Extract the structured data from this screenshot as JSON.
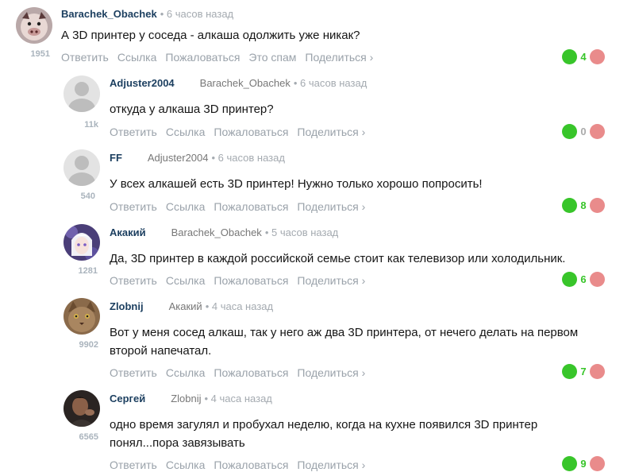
{
  "actions": {
    "reply": "Ответить",
    "link": "Ссылка",
    "report": "Пожаловаться",
    "spam": "Это спам",
    "share": "Поделиться ›"
  },
  "comments": [
    {
      "author": "Barachek_Obachek",
      "reply_to": "",
      "time": "• 6 часов назад",
      "rating": "1951",
      "text": "А 3D принтер у соседа - алкаша одолжить уже никак?",
      "score": "4",
      "score_color": "#38c52a",
      "avatar": "pig-avatar-icon"
    },
    {
      "author": "Adjuster2004",
      "reply_to": "Barachek_Obachek",
      "time": "• 6 часов назад",
      "rating": "11k",
      "text": "откуда у алкаша 3D принтер?",
      "score": "0",
      "score_color": "#aaaaaa",
      "avatar": "default-user-icon"
    },
    {
      "author": "FF",
      "reply_to": "Adjuster2004",
      "time": "• 6 часов назад",
      "rating": "540",
      "text": "У всех алкашей есть 3D принтер! Нужно только хорошо попросить!",
      "score": "8",
      "score_color": "#38c52a",
      "avatar": "default-user-icon"
    },
    {
      "author": "Акакий",
      "reply_to": "Barachek_Obachek",
      "time": "• 5 часов назад",
      "rating": "1281",
      "text": "Да, 3D принтер в каждой российской семье стоит как телевизор или холодильник.",
      "score": "6",
      "score_color": "#38c52a",
      "avatar": "anime-girl-avatar-icon"
    },
    {
      "author": "Zlobnij",
      "reply_to": "Акакий",
      "time": "• 4 часа назад",
      "rating": "9902",
      "text": "Вот у меня сосед алкаш, так у него аж два 3D принтера, от нечего делать на первом второй напечатал.",
      "score": "7",
      "score_color": "#38c52a",
      "avatar": "cat-avatar-icon"
    },
    {
      "author": "Сергей",
      "reply_to": "Zlobnij",
      "time": "• 4 часа назад",
      "rating": "6565",
      "text": "одно время загулял и пробухал неделю, когда на кухне появился 3D принтер понял...пора завязывать",
      "score": "9",
      "score_color": "#38c52a",
      "avatar": "man-avatar-icon"
    }
  ]
}
